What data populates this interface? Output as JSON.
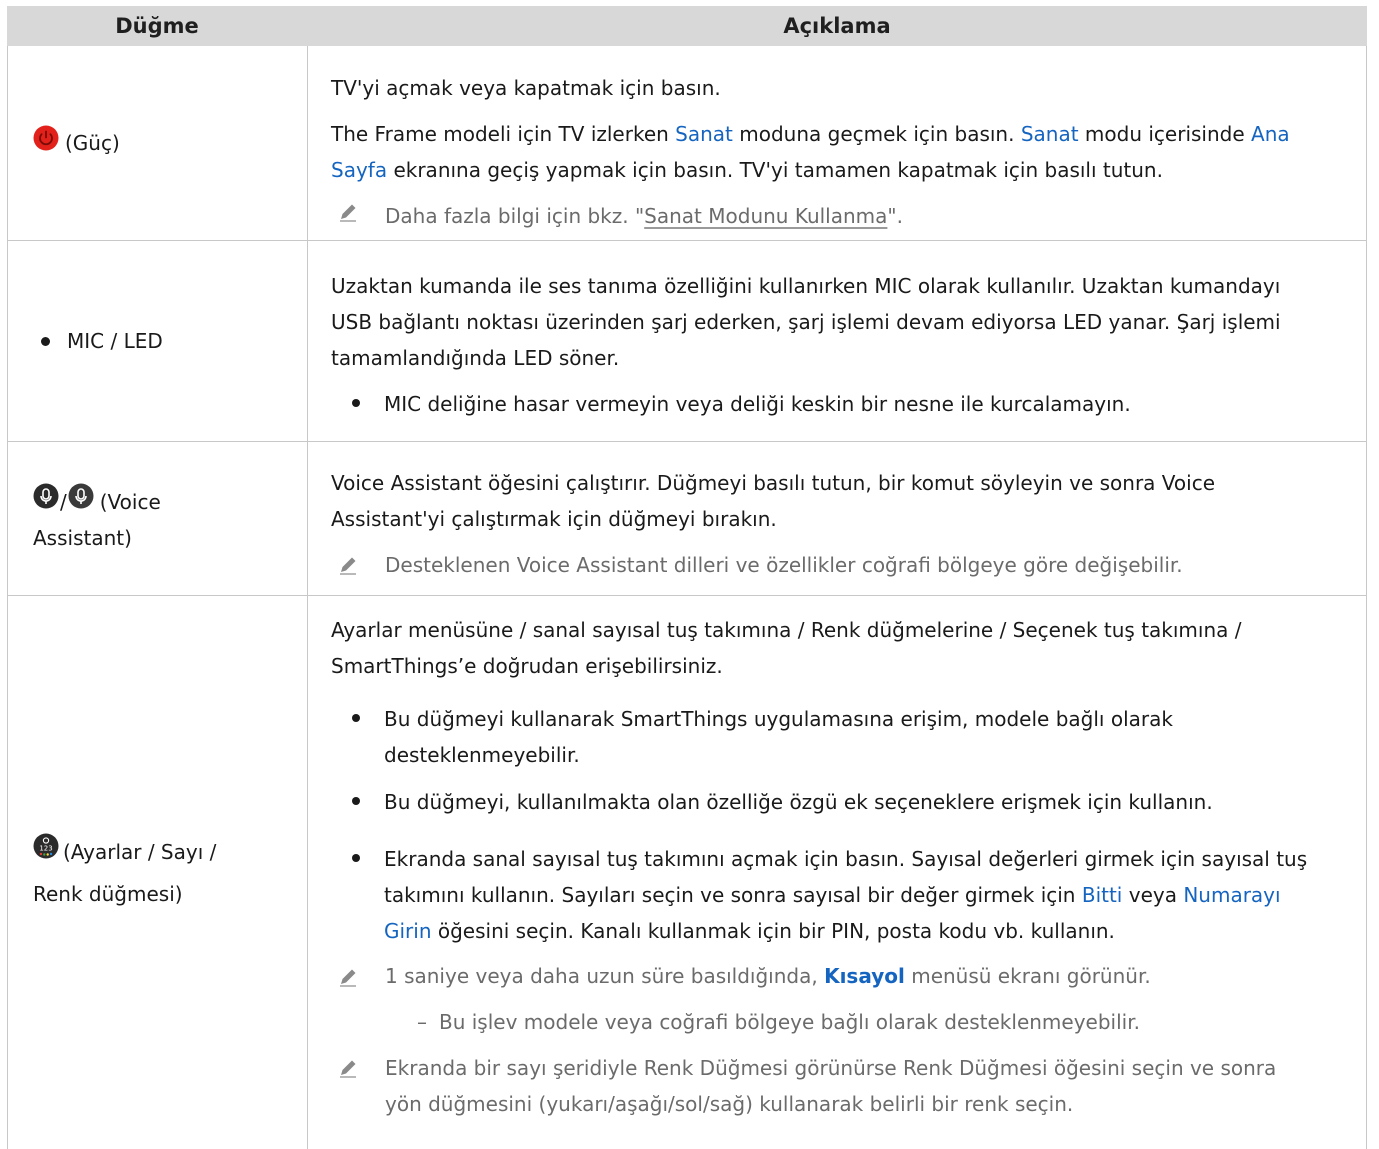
{
  "header": {
    "col1": "Düğme",
    "col2": "Açıklama"
  },
  "rows": [
    {
      "button_label": "(Güç)",
      "p1": "TV'yi açmak veya kapatmak için basın.",
      "p2_a": "The Frame modeli için TV izlerken ",
      "p2_link1": "Sanat",
      "p2_b": " moduna geçmek için basın. ",
      "p2_link2": "Sanat",
      "p2_c": " modu içerisinde ",
      "p2_link3_line1": "Ana",
      "p2_link3_line2": "Sayfa",
      "p2_d": " ekranına geçiş yapmak için basın. TV'yi tamamen kapatmak için basılı tutun.",
      "note_a": "Daha fazla bilgi için bkz. \"",
      "note_link": "Sanat Modunu Kullanma",
      "note_b": "\"."
    },
    {
      "button_label": "MIC / LED",
      "l1": "Uzaktan kumanda ile ses tanıma özelliğini kullanırken MIC olarak kullanılır. Uzaktan kumandayı",
      "l2": "USB bağlantı noktası üzerinden şarj ederken, şarj işlemi devam ediyorsa LED yanar. Şarj işlemi",
      "l3": "tamamlandığında LED söner.",
      "bullet": "MIC deliğine hasar vermeyin veya deliği keskin bir nesne ile kurcalamayın."
    },
    {
      "button_label_l1": "(Voice",
      "button_label_l2": "Assistant)",
      "separator": "/",
      "l1": "Voice Assistant öğesini çalıştırır. Düğmeyi basılı tutun, bir komut söyleyin ve sonra Voice",
      "l2": "Assistant'yi çalıştırmak için düğmeyi bırakın.",
      "note": "Desteklenen Voice Assistant dilleri ve özellikler coğrafi bölgeye göre değişebilir."
    },
    {
      "button_label_l1": "(Ayarlar / Sayı /",
      "button_label_l2": "Renk düğmesi)",
      "icon_text": "123",
      "l1": "Ayarlar menüsüne / sanal sayısal tuş takımına / Renk düğmelerine / Seçenek tuş takımına /",
      "l2": "SmartThings’e doğrudan erişebilirsiniz.",
      "b1_l1": "Bu düğmeyi kullanarak SmartThings uygulamasına erişim, modele bağlı olarak",
      "b1_l2": "desteklenmeyebilir.",
      "b2": "Bu düğmeyi, kullanılmakta olan özelliğe özgü ek seçeneklere erişmek için kullanın.",
      "b3_l1": "Ekranda sanal sayısal tuş takımını açmak için basın. Sayısal değerleri girmek için sayısal tuş",
      "b3_l2_a": "takımını kullanın. Sayıları seçin ve sonra sayısal bir değer girmek için ",
      "b3_link1": "Bitti",
      "b3_l2_b": " veya ",
      "b3_link2_l1": "Numarayı",
      "b3_link2_l2": "Girin",
      "b3_l3": " öğesini seçin. Kanalı kullanmak için bir PIN, posta kodu vb. kullanın.",
      "n1_a": "1 saniye veya daha uzun süre basıldığında, ",
      "n1_link": "Kısayol",
      "n1_b": " menüsü ekranı görünür.",
      "dash": "–",
      "n1_sub": "Bu işlev modele veya coğrafi bölgeye bağlı olarak desteklenmeyebilir.",
      "n2_l1": "Ekranda bir sayı şeridiyle Renk Düğmesi görünürse Renk Düğmesi öğesini seçin ve sonra",
      "n2_l2": "yön düğmesini (yukarı/aşağı/sol/sağ) kullanarak belirli bir renk seçin."
    }
  ],
  "colors": {
    "link": "#1565c0",
    "header_bg": "#d8d8d8",
    "power_red": "#e3211b",
    "note_gray": "#6b6b6b"
  },
  "icons": [
    "power-icon",
    "mic-icon",
    "pencil-note-icon",
    "color-settings-icon"
  ]
}
